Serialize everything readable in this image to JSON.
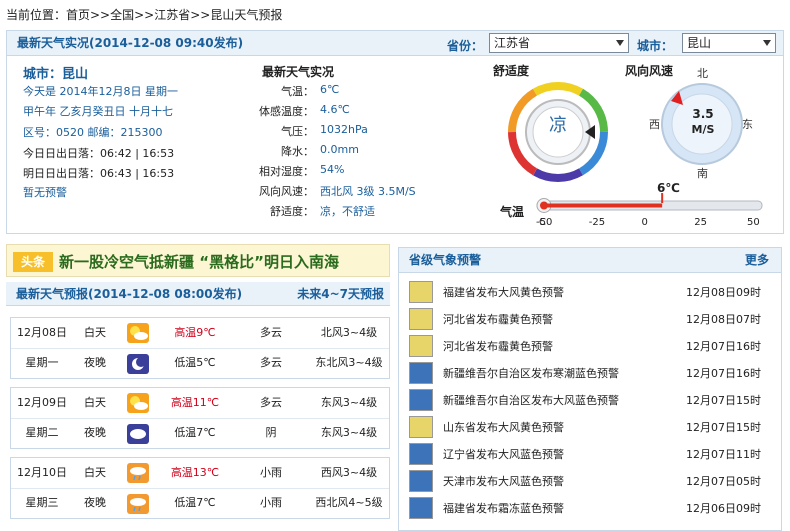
{
  "breadcrumb": "当前位置：首页>>全国>>江苏省>>昆山天气预报",
  "live": {
    "header": "最新天气实况(2014-12-08 09:40发布)",
    "province_label": "省份：",
    "province_value": "江苏省",
    "city_label": "城市：",
    "city_value": "昆山",
    "city_title": "城市：昆山",
    "today": "今天是 2014年12月8日 星期一",
    "lunar": "甲午年 乙亥月癸丑日 十月十七",
    "codes": "区号：0520  邮编：215300",
    "sun_today": "今日日出日落：06:42 | 16:53",
    "sun_tomorrow": "明日日出日落：06:43 | 16:53",
    "no_warning": "暂无预警",
    "title2": "最新天气实况",
    "rows": [
      {
        "k": "气温：",
        "v": "6℃"
      },
      {
        "k": "体感温度：",
        "v": "4.6℃"
      },
      {
        "k": "气压：",
        "v": "1032hPa"
      },
      {
        "k": "降水：",
        "v": "0.0mm"
      },
      {
        "k": "相对湿度：",
        "v": "54%"
      },
      {
        "k": "风向风速：",
        "v": "西北风 3级 3.5M/S"
      },
      {
        "k": "舒适度：",
        "v": "凉，不舒适"
      }
    ],
    "comfort_title": "舒适度",
    "comfort_value": "凉",
    "wind_title": "风向风速",
    "wind_value": "3.5",
    "wind_unit": "M/S",
    "dir_n": "北",
    "dir_s": "南",
    "dir_e": "东",
    "dir_w": "西",
    "temp_label": "气温",
    "temp_current": "6℃",
    "temp_value": 6,
    "temp_scale": [
      "C",
      "-50",
      "-25",
      "0",
      "25",
      "50"
    ]
  },
  "headline": {
    "tag": "头条",
    "text": "新一股冷空气抵新疆 “黑格比”明日入南海"
  },
  "forecast": {
    "header": "最新天气预报(2014-12-08 08:00发布)",
    "more": "未来4~7天预报",
    "days": [
      {
        "date": "12月08日",
        "week": "星期一",
        "d_label": "白天",
        "n_label": "夜晚",
        "hi": "高温9℃",
        "lo": "低温5℃",
        "d_w": "多云",
        "n_w": "多云",
        "d_wind": "北风3~4级",
        "n_wind": "东北风3~4级",
        "d_icon": "partly-cloudy-sun-icon",
        "n_icon": "partly-cloudy-moon-icon"
      },
      {
        "date": "12月09日",
        "week": "星期二",
        "d_label": "白天",
        "n_label": "夜晚",
        "hi": "高温11℃",
        "lo": "低温7℃",
        "d_w": "多云",
        "n_w": "阴",
        "d_wind": "东风3~4级",
        "n_wind": "东风3~4级",
        "d_icon": "partly-cloudy-sun-icon",
        "n_icon": "cloudy-icon"
      },
      {
        "date": "12月10日",
        "week": "星期三",
        "d_label": "白天",
        "n_label": "夜晚",
        "hi": "高温13℃",
        "lo": "低温7℃",
        "d_w": "小雨",
        "n_w": "小雨",
        "d_wind": "西风3~4级",
        "n_wind": "西北风4~5级",
        "d_icon": "light-rain-icon",
        "n_icon": "light-rain-icon"
      }
    ]
  },
  "alerts": {
    "header": "省级气象预警",
    "more": "更多",
    "items": [
      {
        "text": "福建省发布大风黄色预警",
        "time": "12月08日09时",
        "color": "#e8d56a"
      },
      {
        "text": "河北省发布霾黄色预警",
        "time": "12月08日07时",
        "color": "#e8d56a"
      },
      {
        "text": "河北省发布霾黄色预警",
        "time": "12月07日16时",
        "color": "#e8d56a"
      },
      {
        "text": "新疆维吾尔自治区发布寒潮蓝色预警",
        "time": "12月07日16时",
        "color": "#3d73b8"
      },
      {
        "text": "新疆维吾尔自治区发布大风蓝色预警",
        "time": "12月07日15时",
        "color": "#3d73b8"
      },
      {
        "text": "山东省发布大风黄色预警",
        "time": "12月07日15时",
        "color": "#e8d56a"
      },
      {
        "text": "辽宁省发布大风蓝色预警",
        "time": "12月07日11时",
        "color": "#3d73b8"
      },
      {
        "text": "天津市发布大风蓝色预警",
        "time": "12月07日05时",
        "color": "#3d73b8"
      },
      {
        "text": "福建省发布霜冻蓝色预警",
        "time": "12月06日09时",
        "color": "#3d73b8"
      }
    ]
  }
}
